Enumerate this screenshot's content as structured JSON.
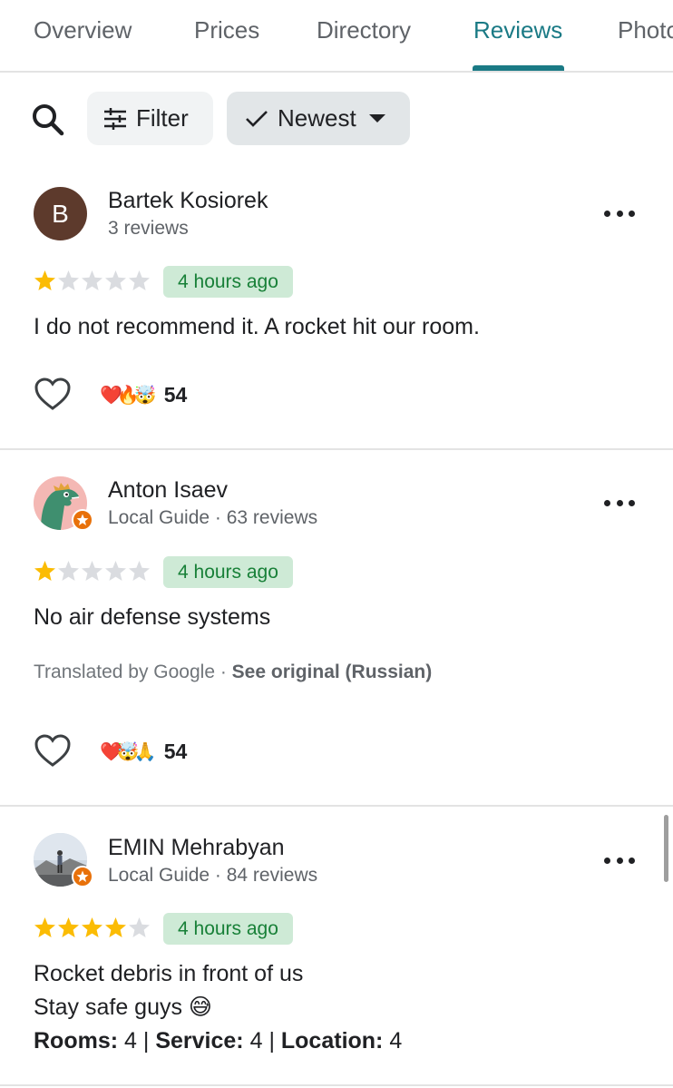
{
  "tabs": [
    {
      "label": "Overview"
    },
    {
      "label": "Prices"
    },
    {
      "label": "Directory"
    },
    {
      "label": "Reviews",
      "active": true
    },
    {
      "label": "Photos"
    }
  ],
  "toolbar": {
    "filter_label": "Filter",
    "sort_label": "Newest"
  },
  "colors": {
    "accent": "#1a7a85",
    "star_filled": "#fbbc04",
    "star_empty": "#dadce0",
    "time_badge_bg": "#ceead6",
    "time_badge_text": "#188038",
    "local_guide_badge": "#e8710a"
  },
  "reviews": [
    {
      "author": "Bartek Kosiorek",
      "avatar_letter": "B",
      "meta": "3 reviews",
      "rating": 1,
      "time": "4 hours ago",
      "text": "I do not recommend it. A rocket hit our room.",
      "reactions": "❤️🔥🤯",
      "reaction_count": "54"
    },
    {
      "author": "Anton Isaev",
      "meta": "Local Guide · 63 reviews",
      "rating": 1,
      "time": "4 hours ago",
      "text": "No air defense systems",
      "translated_note": "Translated by Google · ",
      "see_original": "See original (Russian)",
      "reactions": "❤️🤯🙏",
      "reaction_count": "54"
    },
    {
      "author": "EMIN Mehrabyan",
      "meta": "Local Guide · 84 reviews",
      "rating": 4,
      "time": "4 hours ago",
      "text_line1": "Rocket debris in front of us",
      "text_line2": "Stay safe guys 😅",
      "ratings_line": {
        "rooms_label": "Rooms:",
        "rooms_value": "4",
        "service_label": "Service:",
        "service_value": "4",
        "location_label": "Location:",
        "location_value": "4",
        "sep": "|"
      }
    }
  ]
}
